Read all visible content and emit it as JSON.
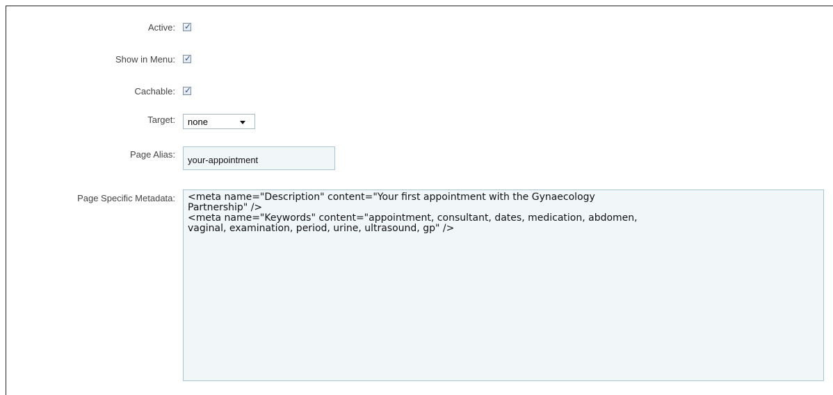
{
  "form": {
    "active": {
      "label": "Active:",
      "checked": true
    },
    "show_in_menu": {
      "label": "Show in Menu:",
      "checked": true
    },
    "cachable": {
      "label": "Cachable:",
      "checked": true
    },
    "target": {
      "label": "Target:",
      "value": "none"
    },
    "page_alias": {
      "label": "Page Alias:",
      "value": "your-appointment"
    },
    "metadata": {
      "label": "Page Specific Metadata:",
      "value": "<meta name=\"Description\" content=\"Your first appointment with the Gynaecology\nPartnership\" />\n<meta name=\"Keywords\" content=\"appointment, consultant, dates, medication, abdomen,\nvaginal, examination, period, urine, ultrasound, gp\" />"
    }
  },
  "icons": {
    "checkmark": "check-icon",
    "dropdown": "chevron-down-icon"
  }
}
